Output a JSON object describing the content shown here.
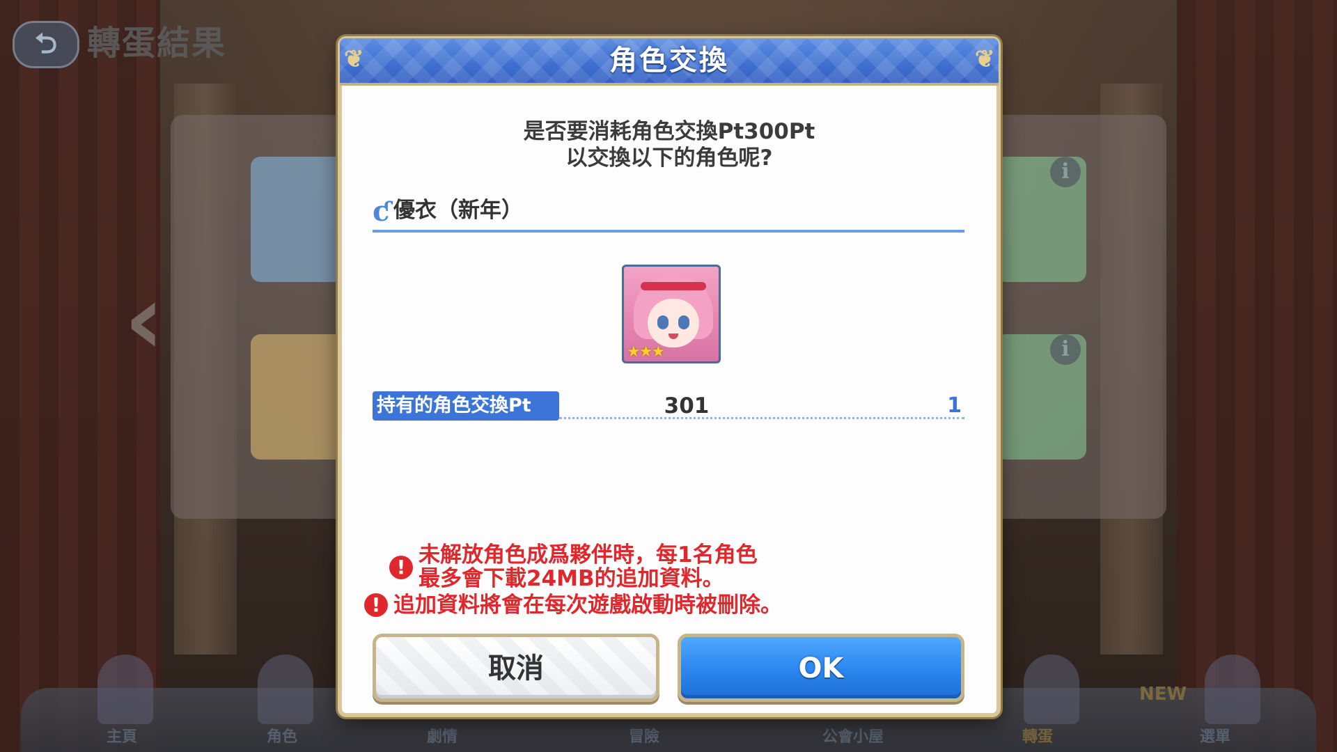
{
  "background": {
    "screen_title": "轉蛋結果",
    "back_icon": "back-arrow-icon",
    "nav_items": [
      "主頁",
      "角色",
      "劇情",
      "冒險",
      "公會小屋",
      "轉蛋",
      "選單"
    ],
    "nav_new_badge": "NEW"
  },
  "dialog": {
    "title": "角色交換",
    "prompt_line1": "是否要消耗角色交換Pt300Pt",
    "prompt_line2": "以交換以下的角色呢?",
    "character_name": "優衣（新年）",
    "character_stars": "★★★",
    "pt_label": "持有的角色交換Pt",
    "pt_current": "301",
    "pt_after": "1",
    "warning1_line1": "未解放角色成爲夥伴時，每1名角色",
    "warning1_line2": "最多會下載24MB的追加資料。",
    "warning2": "追加資料將會在每次遊戲啟動時被刪除。",
    "cancel_label": "取消",
    "ok_label": "OK"
  },
  "colors": {
    "header_blue": "#3e6fd0",
    "ok_blue": "#2a86ee",
    "warning_red": "#e0272c",
    "frame_gold": "#d9c79a"
  }
}
